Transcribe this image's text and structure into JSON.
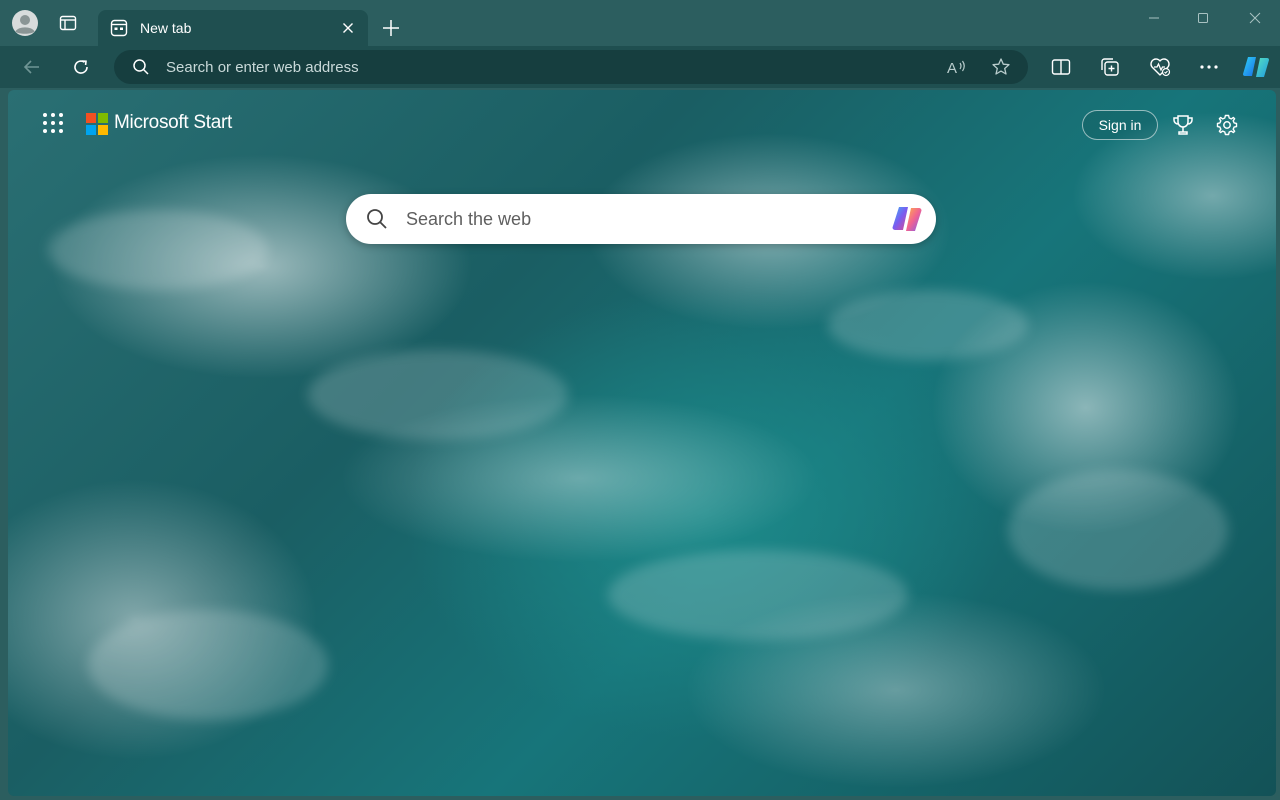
{
  "tab": {
    "title": "New tab"
  },
  "addressbar": {
    "placeholder": "Search or enter web address"
  },
  "newtab_page": {
    "brand": "Microsoft Start",
    "sign_in_label": "Sign in",
    "search_placeholder": "Search the web"
  },
  "colors": {
    "frame": "#2c5e5f",
    "toolbar": "#1f4f50",
    "addressbar": "#163e3f",
    "ms_red": "#f25022",
    "ms_green": "#7fba00",
    "ms_blue": "#00a4ef",
    "ms_yellow": "#ffb900"
  },
  "icons": {
    "profile": "profile-avatar-icon",
    "tab_actions": "tab-actions-icon",
    "tab_favicon": "newtab-favicon-icon",
    "tab_close": "close-icon",
    "new_tab": "plus-icon",
    "minimize": "minimize-icon",
    "maximize": "maximize-icon",
    "window_close": "close-icon",
    "back": "back-arrow-icon",
    "refresh": "refresh-icon",
    "search": "search-icon",
    "read_aloud": "read-aloud-icon",
    "favorite": "star-icon",
    "split_screen": "split-screen-icon",
    "collections": "collections-icon",
    "browser_essentials": "heart-pulse-icon",
    "more": "ellipsis-icon",
    "copilot": "copilot-icon",
    "apps": "app-launcher-icon",
    "rewards": "trophy-icon",
    "settings": "gear-icon"
  }
}
